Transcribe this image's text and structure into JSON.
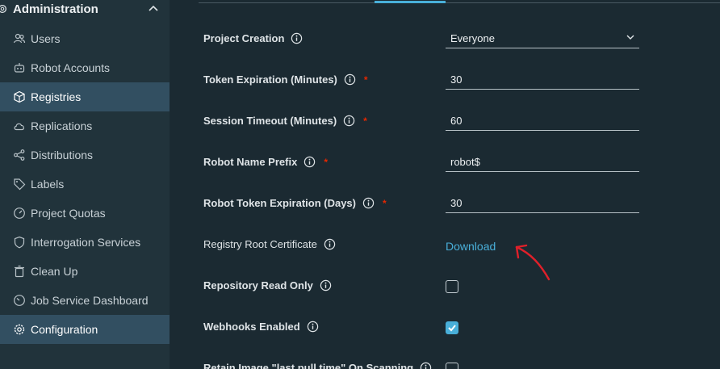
{
  "sidebar": {
    "section_title": "Administration",
    "items": [
      {
        "label": "Users",
        "icon": "users-icon"
      },
      {
        "label": "Robot Accounts",
        "icon": "robot-icon"
      },
      {
        "label": "Registries",
        "icon": "cube-icon"
      },
      {
        "label": "Replications",
        "icon": "cloud-icon"
      },
      {
        "label": "Distributions",
        "icon": "share-icon"
      },
      {
        "label": "Labels",
        "icon": "tag-icon"
      },
      {
        "label": "Project Quotas",
        "icon": "gauge-icon"
      },
      {
        "label": "Interrogation Services",
        "icon": "shield-icon"
      },
      {
        "label": "Clean Up",
        "icon": "trash-icon"
      },
      {
        "label": "Job Service Dashboard",
        "icon": "dashboard-icon"
      },
      {
        "label": "Configuration",
        "icon": "gear-icon"
      }
    ]
  },
  "config": {
    "project_creation": {
      "label": "Project Creation",
      "value": "Everyone"
    },
    "token_expiration": {
      "label": "Token Expiration (Minutes)",
      "value": "30"
    },
    "session_timeout": {
      "label": "Session Timeout (Minutes)",
      "value": "60"
    },
    "robot_name_prefix": {
      "label": "Robot Name Prefix",
      "value": "robot$"
    },
    "robot_token_expiration": {
      "label": "Robot Token Expiration (Days)",
      "value": "30"
    },
    "registry_root_cert": {
      "label": "Registry Root Certificate",
      "link": "Download"
    },
    "repo_read_only": {
      "label": "Repository Read Only",
      "checked": false
    },
    "webhooks_enabled": {
      "label": "Webhooks Enabled",
      "checked": true
    },
    "retain_pull_time": {
      "label": "Retain Image \"last pull time\" On Scanning",
      "checked": false
    },
    "required_marker": "*"
  },
  "colors": {
    "accent": "#49afd9",
    "required": "#e62700",
    "annotation": "#e0202a",
    "active_nav": "#324f61"
  }
}
